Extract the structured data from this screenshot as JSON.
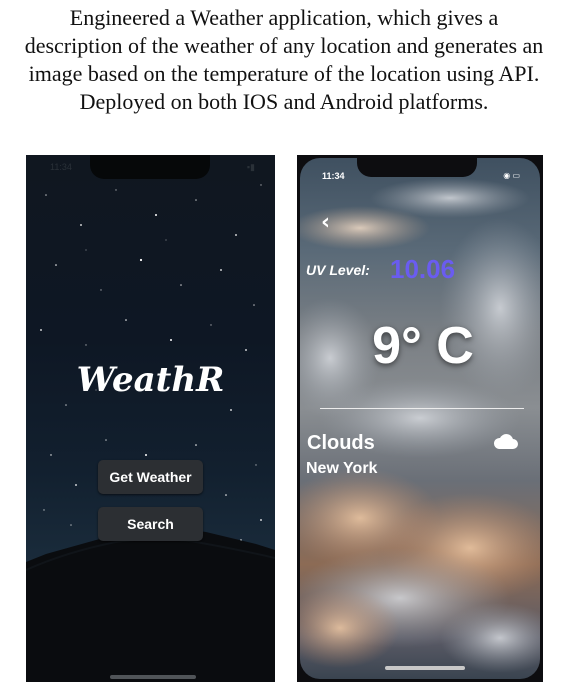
{
  "caption": "Engineered a Weather application, which gives a description of the weather of any location and generates an image based on the temperature of the location using API. Deployed on both IOS and Android platforms.",
  "left_screen": {
    "status_time": "11:34",
    "logo": "WeathR",
    "get_weather_label": "Get Weather",
    "search_label": "Search",
    "colors": {
      "background": "#0f1419",
      "button": "#2c2f33"
    }
  },
  "right_screen": {
    "status_time": "11:34",
    "back_icon": "chevron-left-icon",
    "uv_label": "UV Level:",
    "uv_value": "10.06",
    "temperature": "9° C",
    "condition": "Clouds",
    "condition_icon": "cloud-icon",
    "city": "New York",
    "colors": {
      "uv_value": "#6a5cf0",
      "text": "#ffffff"
    }
  }
}
